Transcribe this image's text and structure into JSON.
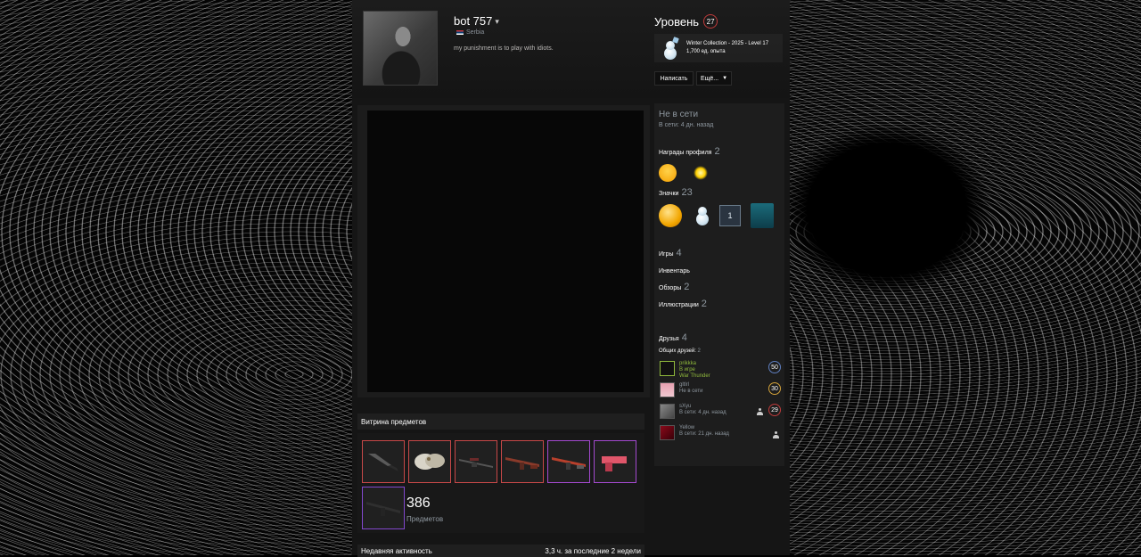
{
  "profile": {
    "persona_name": "bot 757",
    "country": "Serbia",
    "summary": "my punishment is to play with idiots.",
    "level_label": "Уровень",
    "level": "27"
  },
  "favorite_badge": {
    "name": "Winter Collection - 2025 - Level 17",
    "xp": "1,700 ед. опыта"
  },
  "buttons": {
    "message": "Написать",
    "more": "Ещё..."
  },
  "status": {
    "title": "Не в сети",
    "last_online": "В сети: 4 дн. назад"
  },
  "sidebar": {
    "awards_label": "Награды профиля",
    "awards_count": "2",
    "badges_label": "Значки",
    "badges_count": "23",
    "games_label": "Игры",
    "games_count": "4",
    "inventory_label": "Инвентарь",
    "reviews_label": "Обзоры",
    "reviews_count": "2",
    "artwork_label": "Иллюстрации",
    "artwork_count": "2",
    "friends_label": "Друзья",
    "friends_count": "4",
    "mutual_label": "Общих друзей:",
    "mutual_count": "2"
  },
  "friends": [
    {
      "name": "prikkka",
      "line2": "В игре",
      "line3": "War Thunder",
      "level": "50",
      "color": "#90ba3c",
      "ring": "#5f7fc0"
    },
    {
      "name": "gltlrl",
      "line2": "Не в сети",
      "line3": "",
      "level": "30",
      "color": "#8f98a0",
      "ring": "#d3a23a"
    },
    {
      "name": "sXyu",
      "line2": "В сети: 4 дн. назад",
      "line3": "",
      "level": "29",
      "color": "#8f98a0",
      "ring": "#c03b3b"
    },
    {
      "name": "Yellow",
      "line2": "В сети: 21 дн. назад",
      "line3": "",
      "level": "",
      "color": "#8f98a0",
      "ring": ""
    }
  ],
  "showcase": {
    "title": "Витрина предметов",
    "count": "386",
    "count_label": "Предметов",
    "items": [
      {
        "icon": "knife-icon",
        "border": "#c74848"
      },
      {
        "icon": "gloves-icon",
        "border": "#c74848"
      },
      {
        "icon": "sniper-rifle-icon",
        "border": "#c74848"
      },
      {
        "icon": "rifle-icon",
        "border": "#c74848"
      },
      {
        "icon": "rifle-icon",
        "border": "#a349cf"
      },
      {
        "icon": "pistol-icon",
        "border": "#a349cf"
      },
      {
        "icon": "rifle-icon",
        "border": "#8348cf"
      }
    ]
  },
  "activity": {
    "title": "Недавняя активность",
    "hours": "3,3 ч. за последние 2 недели"
  }
}
